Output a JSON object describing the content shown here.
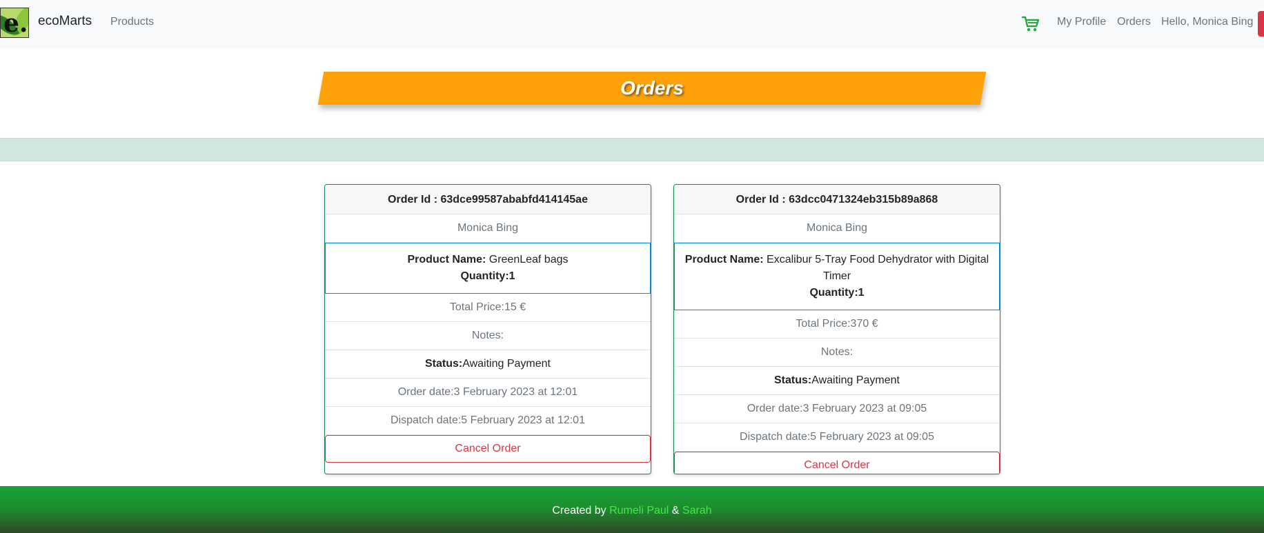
{
  "nav": {
    "brand": "ecoMarts",
    "logo_letter": "e.",
    "products": "Products",
    "my_profile": "My Profile",
    "orders": "Orders",
    "greeting": "Hello, Monica Bing",
    "cart_icon": "shopping-cart-icon",
    "cart_color": "#28a745"
  },
  "banner": {
    "title": "Orders",
    "color": "#ffa20a"
  },
  "orders": [
    {
      "order_id": "Order Id : 63dce99587ababfd414145ae",
      "customer": "Monica Bing",
      "product_label": "Product Name:",
      "product_name": "GreenLeaf bags",
      "quantity": "Quantity:1",
      "total_price": "Total Price:15 €",
      "notes": "Notes:",
      "status_label": "Status:",
      "status_value": "Awaiting Payment",
      "order_date": "Order date:3 February 2023 at 12:01",
      "dispatch_date": "Dispatch date:5 February 2023 at 12:01",
      "cancel_label": "Cancel Order"
    },
    {
      "order_id": "Order Id : 63dcc0471324eb315b89a868",
      "customer": "Monica Bing",
      "product_label": "Product Name:",
      "product_name": "Excalibur 5-Tray Food Dehydrator with Digital Timer",
      "quantity": "Quantity:1",
      "total_price": "Total Price:370 €",
      "notes": "Notes:",
      "status_label": "Status:",
      "status_value": "Awaiting Payment",
      "order_date": "Order date:3 February 2023 at 09:05",
      "dispatch_date": "Dispatch date:5 February 2023 at 09:05",
      "cancel_label": "Cancel Order"
    }
  ],
  "footer": {
    "prefix": "Created by",
    "author1": "Rumeli Paul",
    "separator": "&",
    "author2": "Sarah"
  }
}
